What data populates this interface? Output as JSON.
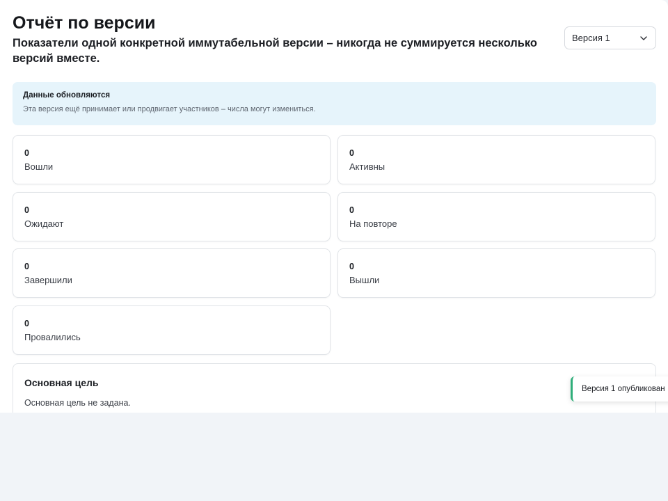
{
  "header": {
    "title": "Отчёт по версии",
    "subtitle": "Показатели одной конкретной иммутабельной версии – никогда не суммируется несколько версий вместе."
  },
  "version_select": {
    "selected": "Версия 1",
    "icon": "chevron-down-icon"
  },
  "notice": {
    "title": "Данные обновляются",
    "text": "Эта версия ещё принимает или продвигает участников – числа могут измениться."
  },
  "stats": [
    {
      "value": "0",
      "label": "Вошли"
    },
    {
      "value": "0",
      "label": "Активны"
    },
    {
      "value": "0",
      "label": "Ожидают"
    },
    {
      "value": "0",
      "label": "На повторе"
    },
    {
      "value": "0",
      "label": "Завершили"
    },
    {
      "value": "0",
      "label": "Вышли"
    },
    {
      "value": "0",
      "label": "Провалились"
    }
  ],
  "goal": {
    "title": "Основная цель",
    "text": "Основная цель не задана."
  },
  "toast": {
    "text": "Версия 1 опубликован",
    "accent_color": "#2fae7a"
  },
  "colors": {
    "notice_bg": "#e6f4fb",
    "page_bg": "#f1f4f8"
  }
}
